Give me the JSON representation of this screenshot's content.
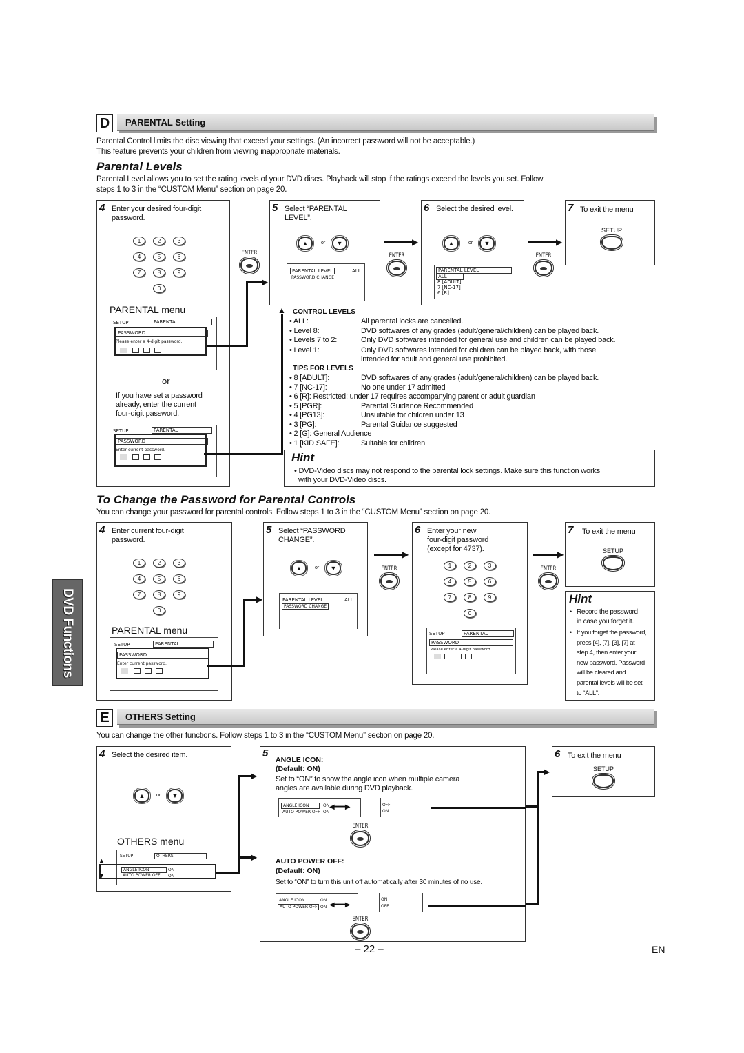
{
  "common": {
    "enter": "ENTER",
    "setup": "SETUP",
    "or": "or",
    "dotted_or": "or"
  },
  "keypad_digits": [
    "1",
    "2",
    "3",
    "4",
    "5",
    "6",
    "7",
    "8",
    "9",
    "0"
  ],
  "section_d": {
    "letter": "D",
    "title": "PARENTAL Setting",
    "intro": [
      "Parental Control limits the disc viewing that exceed your settings. (An incorrect password will not be acceptable.)",
      "This feature prevents your children from viewing inappropriate materials."
    ],
    "levels_title": "Parental Levels",
    "levels_text": [
      "Parental Level allows you to set the rating levels of your DVD discs. Playback will stop if the ratings exceed the levels you set. Follow",
      "steps 1 to 3 in the “CUSTOM Menu” section on page 20."
    ],
    "step4": {
      "num": "4",
      "text": [
        "Enter your desired four-digit",
        "password."
      ]
    },
    "menu_label": "PARENTAL menu",
    "screen_a": {
      "setup": "SETUP",
      "tab": "PARENTAL",
      "field": "PASSWORD",
      "prompt": "Please enter a 4-digit password."
    },
    "already": [
      "If you have set a password",
      "already, enter the current",
      "four-digit password."
    ],
    "screen_b": {
      "setup": "SETUP",
      "tab": "PARENTAL",
      "field": "PASSWORD",
      "prompt": "Enter current password."
    },
    "step5": {
      "num": "5",
      "text": [
        "Select “PARENTAL",
        "LEVEL”."
      ],
      "menu": {
        "item1": "PARENTAL LEVEL",
        "value1": "ALL",
        "item2": "PASSWORD CHANGE"
      }
    },
    "step6": {
      "num": "6",
      "text": "Select the desired level.",
      "menu": {
        "title": "PARENTAL LEVEL",
        "sel": "ALL",
        "rows": [
          "8 [ADULT]",
          "7 [NC-17]",
          "6 [R]"
        ]
      }
    },
    "step7": {
      "num": "7",
      "text": "To exit the menu"
    },
    "control_levels": {
      "title": "CONTROL LEVELS",
      "rows": [
        {
          "k": "• ALL:",
          "v": "All parental locks are cancelled."
        },
        {
          "k": "• Level 8:",
          "v": "DVD softwares of any grades (adult/general/children) can be played back."
        },
        {
          "k": "• Levels 7 to 2:",
          "v": "Only DVD softwares intended for general use and children can be played back."
        },
        {
          "k": "• Level 1:",
          "v": "Only DVD softwares intended for children can be played back, with those",
          "v2": "intended for adult and general use prohibited."
        }
      ]
    },
    "tips": {
      "title": "TIPS FOR LEVELS",
      "rows": [
        {
          "k": "• 8 [ADULT]:",
          "v": "DVD softwares of any grades (adult/general/children) can be played back."
        },
        {
          "k": "• 7 [NC-17]:",
          "v": "No one under 17 admitted"
        },
        {
          "k": "• 6 [R]: Restricted; under 17 requires accompanying parent or adult guardian",
          "v": ""
        },
        {
          "k": "• 5 [PGR]:",
          "v": "Parental Guidance Recommended"
        },
        {
          "k": "• 4 [PG13]:",
          "v": "Unsuitable for children under 13"
        },
        {
          "k": "• 3 [PG]:",
          "v": "Parental Guidance suggested"
        },
        {
          "k": "• 2 [G]: General Audience",
          "v": ""
        },
        {
          "k": "• 1 [KID SAFE]:",
          "v": "Suitable for children"
        }
      ]
    },
    "hint": {
      "title": "Hint",
      "lines": [
        "• DVD-Video discs may not respond to the parental lock settings. Make sure this function works",
        "with your DVD-Video discs."
      ]
    }
  },
  "password": {
    "title": "To Change the Password for Parental Controls",
    "text": "You can change your password for parental controls.  Follow steps 1 to 3 in the “CUSTOM Menu” section on page 20.",
    "step4": {
      "num": "4",
      "text": [
        "Enter current four-digit",
        "password."
      ]
    },
    "menu_label": "PARENTAL menu",
    "screen": {
      "setup": "SETUP",
      "tab": "PARENTAL",
      "field": "PASSWORD",
      "prompt": "Enter current password."
    },
    "step5": {
      "num": "5",
      "text": [
        "Select “PASSWORD",
        "CHANGE”."
      ],
      "menu": {
        "item1": "PARENTAL LEVEL",
        "value1": "ALL",
        "item2": "PASSWORD CHANGE"
      }
    },
    "step6": {
      "num": "6",
      "text": [
        "Enter your new",
        "four-digit password",
        "(except for 4737)."
      ],
      "screen": {
        "setup": "SETUP",
        "tab": "PARENTAL",
        "field": "PASSWORD",
        "prompt": "Please enter a 4-digit password."
      }
    },
    "step7": {
      "num": "7",
      "text": "To exit the menu"
    },
    "hint": {
      "title": "Hint",
      "items": [
        [
          "Record the password",
          "in case you forget it."
        ],
        [
          "If you forget the password,",
          "press [4], [7], [3], [7] at",
          "step 4, then enter your",
          "new password. Password",
          "will be cleared and",
          "parental levels will be set",
          "to “ALL”."
        ]
      ]
    }
  },
  "side_tab": "DVD Functions",
  "section_e": {
    "letter": "E",
    "title": "OTHERS Setting",
    "text": "You can change the other functions. Follow steps 1 to 3 in the “CUSTOM Menu” section on page 20.",
    "step4": {
      "num": "4",
      "text": "Select the desired item."
    },
    "menu_label": "OTHERS menu",
    "screen": {
      "setup": "SETUP",
      "tab": "OTHERS",
      "row1": "ANGLE ICON",
      "val1": "ON",
      "row2": "AUTO POWER OFF",
      "val2": "ON"
    },
    "step5": {
      "num": "5",
      "angle": {
        "title": "ANGLE ICON:",
        "default": "(Default: ON)",
        "text": [
          "Set to “ON” to show the angle icon when multiple camera",
          "angles are available during DVD playback."
        ],
        "left": {
          "r1": "ANGLE ICON",
          "v1": "ON",
          "r2": "AUTO POWER OFF",
          "v2": "ON"
        },
        "right": [
          "OFF",
          "ON"
        ]
      },
      "auto": {
        "title": "AUTO POWER OFF:",
        "default": "(Default: ON)",
        "text": "Set to “ON” to turn this unit off automatically after 30 minutes of no use.",
        "left": {
          "r1": "ANGLE ICON",
          "v1": "ON",
          "r2": "AUTO POWER OFF",
          "v2": "ON"
        },
        "right": [
          "ON",
          "OFF"
        ]
      }
    },
    "step6": {
      "num": "6",
      "text": "To exit the menu"
    }
  },
  "footer": {
    "page": "– 22 –",
    "lang": "EN"
  }
}
